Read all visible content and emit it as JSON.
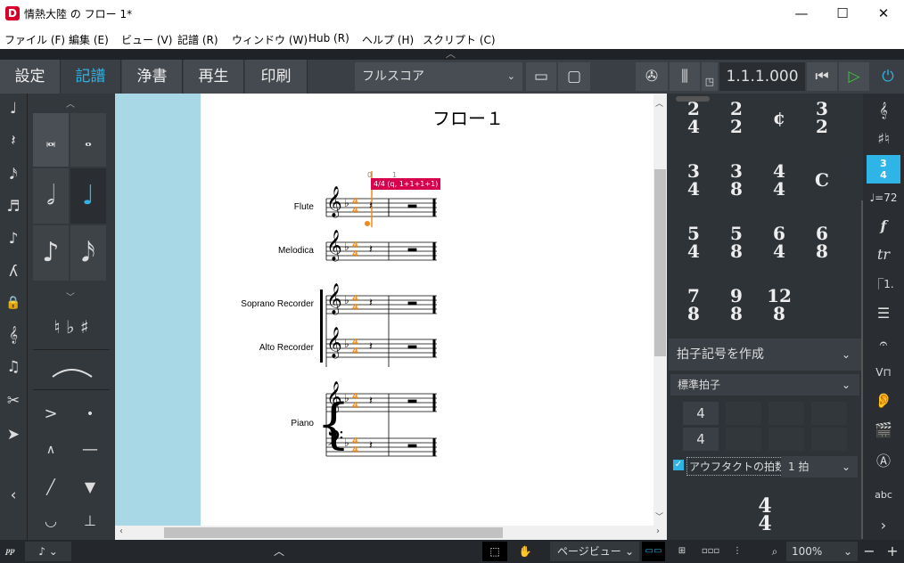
{
  "window": {
    "title": "情熱大陸 の フロー 1*",
    "min": "—",
    "max": "☐",
    "close": "✕"
  },
  "menu": [
    "ファイル (F)",
    "編集 (E)",
    "ビュー (V)",
    "記譜 (R)",
    "ウィンドウ (W)",
    "Hub (R)",
    "ヘルプ (H)",
    "スクリプト (C)"
  ],
  "tabs": [
    "設定",
    "記譜",
    "浄書",
    "再生",
    "印刷"
  ],
  "layout_select": "フルスコア",
  "position": "1.1.1.000",
  "score": {
    "title": "フロー１",
    "instruments": [
      "Flute",
      "Melodica",
      "Soprano Recorder",
      "Alto Recorder",
      "Piano"
    ],
    "popover": "4/4 (q, 1+1+1+1)",
    "ruler": [
      "0",
      "1"
    ],
    "time_sig": "4/4"
  },
  "timesigs": [
    [
      "2",
      "4"
    ],
    [
      "2",
      "2"
    ],
    [
      "¢",
      ""
    ],
    [
      "3",
      "2"
    ],
    [
      "3",
      "4"
    ],
    [
      "3",
      "8"
    ],
    [
      "4",
      "4"
    ],
    [
      "C",
      ""
    ],
    [
      "5",
      "4"
    ],
    [
      "5",
      "8"
    ],
    [
      "6",
      "4"
    ],
    [
      "6",
      "8"
    ],
    [
      "7",
      "8"
    ],
    [
      "9",
      "8"
    ],
    [
      "12",
      "8"
    ]
  ],
  "create_panel": {
    "title": "拍子記号を作成",
    "type": "標準拍子",
    "numerator": "4",
    "denominator": "4",
    "pickup_label": "アウフタクトの拍数:",
    "pickup_value": "1 拍",
    "preview": [
      "4",
      "4"
    ]
  },
  "status": {
    "view": "ページビュー",
    "zoom": "100%"
  },
  "colors": {
    "accent": "#2fb4e8",
    "popover": "#d6004c",
    "signature": "#f08a1c"
  }
}
